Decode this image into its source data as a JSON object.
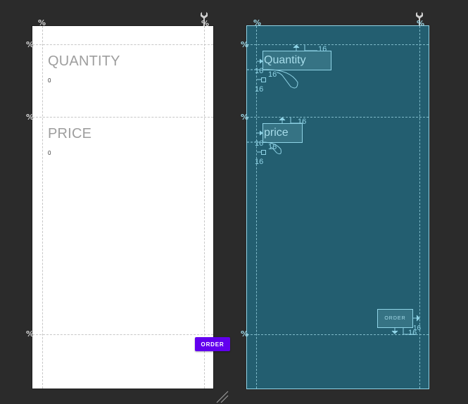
{
  "design": {
    "heading_quantity": "QUANTITY",
    "value_quantity": "0",
    "heading_price": "PRICE",
    "value_price": "0",
    "order_button": "ORDER"
  },
  "blueprint": {
    "label_quantity": "Quantity",
    "label_price": "price",
    "label_order": "ORDER",
    "margin": "16"
  },
  "guideline_marker": "%",
  "colors": {
    "canvas_background": "#2b2b2b",
    "blueprint_background": "#235e70",
    "blueprint_accent": "#8fd3e6",
    "order_button": "#6200ee",
    "heading_text": "#9e9e9e"
  }
}
